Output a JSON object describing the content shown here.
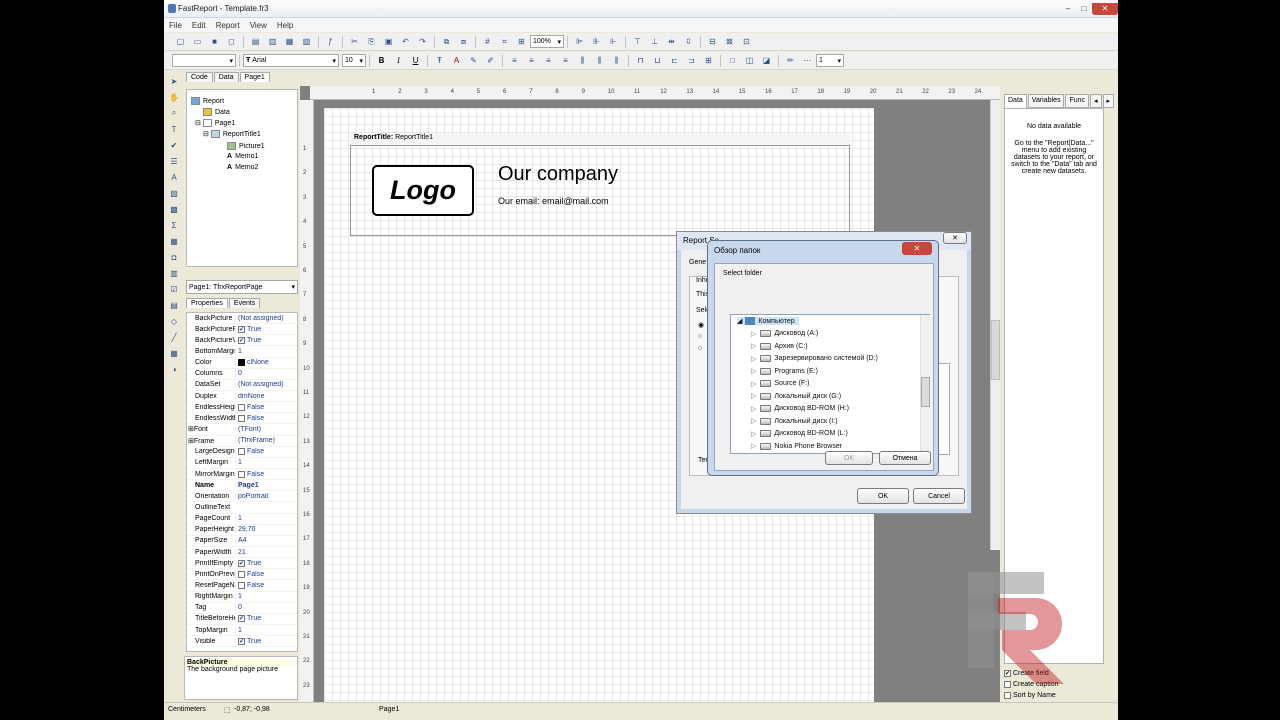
{
  "window": {
    "title": "FastReport - Template.fr3",
    "min": "–",
    "max": "□",
    "close": "✕"
  },
  "menu": [
    "File",
    "Edit",
    "Report",
    "View",
    "Help"
  ],
  "toolbar": {
    "zoom": "100%",
    "font": "Arial",
    "size": "10",
    "line_width": "1",
    "bold": "B",
    "italic": "I",
    "underline": "U"
  },
  "doc_tabs": [
    "Code",
    "Data",
    "Page1"
  ],
  "tree": {
    "items": [
      "Report",
      "Data",
      "Page1",
      "ReportTitle1",
      "Picture1",
      "Memo1",
      "Memo2"
    ]
  },
  "objects_combo": "Page1: TfrxReportPage",
  "prop_tabs": [
    "Properties",
    "Events"
  ],
  "properties": [
    {
      "name": "BackPicture",
      "value": "(Not assigned)",
      "check": false
    },
    {
      "name": "BackPicturePr",
      "value": "True",
      "check": true
    },
    {
      "name": "BackPictureVi",
      "value": "True",
      "check": true
    },
    {
      "name": "BottomMargin",
      "value": "1",
      "check": false
    },
    {
      "name": "Color",
      "value": "clNone",
      "check": false
    },
    {
      "name": "Columns",
      "value": "0",
      "check": false
    },
    {
      "name": "DataSet",
      "value": "(Not assigned)",
      "check": false
    },
    {
      "name": "Duplex",
      "value": "dmNone",
      "check": false
    },
    {
      "name": "EndlessHeigh",
      "value": "False",
      "check": true
    },
    {
      "name": "EndlessWidth",
      "value": "False",
      "check": true
    },
    {
      "name": "Font",
      "value": "(TFont)",
      "check": false
    },
    {
      "name": "Frame",
      "value": "(TfrxFrame)",
      "check": false
    },
    {
      "name": "LargeDesign",
      "value": "False",
      "check": true
    },
    {
      "name": "LeftMargin",
      "value": "1",
      "check": false
    },
    {
      "name": "MirrorMargin",
      "value": "False",
      "check": true
    },
    {
      "name": "Name",
      "value": "Page1",
      "check": false
    },
    {
      "name": "Orientation",
      "value": "poPortrait",
      "check": false
    },
    {
      "name": "OutlineText",
      "value": "",
      "check": false
    },
    {
      "name": "PageCount",
      "value": "1",
      "check": false
    },
    {
      "name": "PaperHeight",
      "value": "29,70",
      "check": false
    },
    {
      "name": "PaperSize",
      "value": "A4",
      "check": false
    },
    {
      "name": "PaperWidth",
      "value": "21",
      "check": false
    },
    {
      "name": "PrintIfEmpty",
      "value": "True",
      "check": true
    },
    {
      "name": "PrintOnPrevi",
      "value": "False",
      "check": true
    },
    {
      "name": "ResetPageNu",
      "value": "False",
      "check": true
    },
    {
      "name": "RightMargin",
      "value": "1",
      "check": false
    },
    {
      "name": "Tag",
      "value": "0",
      "check": false
    },
    {
      "name": "TitleBeforeHe",
      "value": "True",
      "check": true
    },
    {
      "name": "TopMargin",
      "value": "1",
      "check": false
    },
    {
      "name": "Visible",
      "value": "True",
      "check": true
    }
  ],
  "description": {
    "title": "BackPicture",
    "text": "The background page picture"
  },
  "canvas": {
    "band_label": "ReportTitle:",
    "band_name": "ReportTitle1",
    "logo_text": "Logo",
    "company": "Our company",
    "email": "Our email: email@mail.com"
  },
  "ruler_numbers": [
    "1",
    "2",
    "3",
    "4",
    "5",
    "6",
    "7",
    "8",
    "9",
    "10",
    "11",
    "12",
    "13",
    "14",
    "15",
    "16",
    "17",
    "18",
    "19",
    "20",
    "21",
    "22",
    "23",
    "24"
  ],
  "vruler_numbers": [
    "1",
    "2",
    "3",
    "4",
    "5",
    "6",
    "7",
    "8",
    "9",
    "10",
    "11",
    "12",
    "13",
    "14",
    "15",
    "16",
    "17",
    "18",
    "19",
    "20",
    "21",
    "22",
    "23",
    "24"
  ],
  "right_panel": {
    "tabs": [
      "Data",
      "Variables",
      "Func"
    ],
    "no_data": "No data available",
    "hint": "Go to the \"Report|Data...\" menu to add existing datasets to your report, or switch to the \"Data\" tab and create new datasets.",
    "checks": [
      {
        "label": "Create field",
        "checked": true
      },
      {
        "label": "Create caption",
        "checked": false
      },
      {
        "label": "Sort by Name",
        "checked": false
      }
    ]
  },
  "status": {
    "units": "Centimeters",
    "coords": "-0,87; -0,98",
    "page": "Page1"
  },
  "dialog_back": {
    "title": "Report Se",
    "gen": "Gene",
    "inh": "Inhe",
    "this": "This",
    "sel": "Sele",
    "tem": "Tem",
    "ok": "OK",
    "cancel": "Cancel"
  },
  "dialog_folder": {
    "title": "Обзор папок",
    "prompt": "Select folder",
    "root": "Компьютер",
    "drives": [
      "Дисковод (A:)",
      "Архив (C:)",
      "Зарезервировано системой (D:)",
      "Programs (E:)",
      "Source (F:)",
      "Локальный диск (G:)",
      "Дисковод BD-ROM (H:)",
      "Локальный диск (I:)",
      "Дисковод BD-ROM (L:)",
      "Nokia Phone Browser"
    ],
    "ok": "OK",
    "cancel": "Отмена"
  }
}
